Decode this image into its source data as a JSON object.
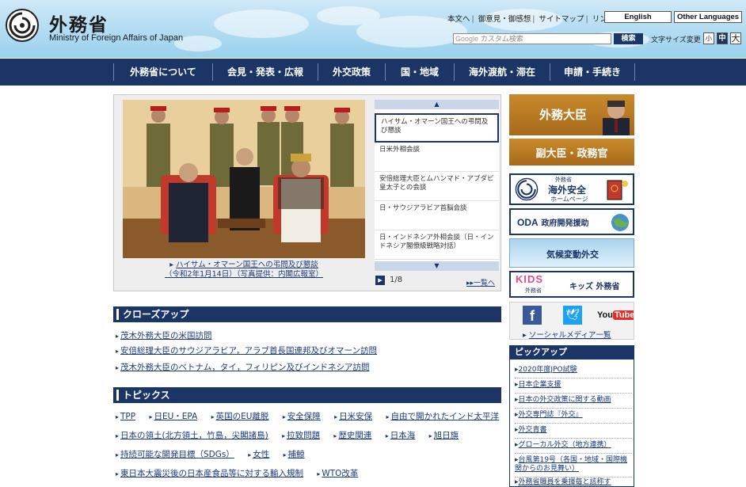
{
  "header": {
    "site_name_jp": "外務省",
    "site_name_en": "Ministry of Foreign Affairs of Japan",
    "util_links": [
      "本文へ",
      "御意見・御感想",
      "サイトマップ",
      "リンク集"
    ],
    "lang_english": "English",
    "lang_other": "Other Languages",
    "search_brand": "Google",
    "search_placeholder": "カスタム検索",
    "search_button": "検索",
    "fontsize_label": "文字サイズ変更",
    "fontsize_small": "小",
    "fontsize_mid": "中",
    "fontsize_large": "大"
  },
  "nav": [
    "外務省について",
    "会見・発表・広報",
    "外交政策",
    "国・地域",
    "海外渡航・滞在",
    "申請・手続き"
  ],
  "carousel": {
    "caption_line1": "ハイサム・オマーン国王への弔問及び懇談",
    "caption_line2": "（令和2年1月14日）（写真提供：内閣広報室）",
    "items": [
      "ハイサム・オマーン国王への弔問及び懇談",
      "日米外相会談",
      "安倍総理大臣とムハンマド・アブダビ皇太子との会談",
      "日・サウジアラビア首脳会談",
      "日・インドネシア外相会談（日・インドネシア閣僚級戦略対話）"
    ],
    "pager": "1/8",
    "list_link": "一覧へ"
  },
  "closeup": {
    "title": "クローズアップ",
    "links": [
      "茂木外務大臣の米国訪問",
      "安倍総理大臣のサウジアラビア，アラブ首長国連邦及びオマーン訪問",
      "茂木外務大臣のベトナム，タイ，フィリピン及びインドネシア訪問"
    ]
  },
  "topics": {
    "title": "トピックス",
    "row1": [
      "TPP",
      "日EU・EPA",
      "英国のEU離脱",
      "安全保障",
      "日米安保",
      "自由で開かれたインド太平洋"
    ],
    "row2": [
      "日本の領土(北方領土，竹島，尖閣諸島)",
      "拉致問題",
      "歴史関連",
      "日本海",
      "旭日旗"
    ],
    "row3": [
      "持続可能な開発目標（SDGs）",
      "女性",
      "捕鯨"
    ],
    "row4": [
      "東日本大震災後の日本産食品等に対する輸入規制",
      "WTO改革"
    ]
  },
  "banners": {
    "minister": "外務大臣",
    "vice": "副大臣・政務官",
    "safety_org": "外務省",
    "safety_l1": "海外安全",
    "safety_l2": "ホームページ",
    "oda_bold": "ODA",
    "oda_rest": "政府開発援助",
    "climate": "気候変動外交",
    "kids_logo": "KIDS",
    "kids_sub": "外務省",
    "kids_text": "キッズ 外務省",
    "youtube": "YouTube",
    "social_link": "ソーシャルメディア一覧"
  },
  "pickup": {
    "title": "ピックアップ",
    "items": [
      "2020年度JPO試験",
      "日本企業支援",
      "日本の外交政策に関する動画",
      "外交専門誌『外交』",
      "外交青書",
      "グローカル外交（地方連携）",
      "台風第19号（各国・地域・国際機関からのお見舞い）",
      "外務省職員を乗揮毎と該称す"
    ]
  },
  "colors": {
    "navy": "#1b3566",
    "link": "#1a3a7a",
    "header_sky": "#a9d8f1",
    "brown": "#b8741c"
  }
}
